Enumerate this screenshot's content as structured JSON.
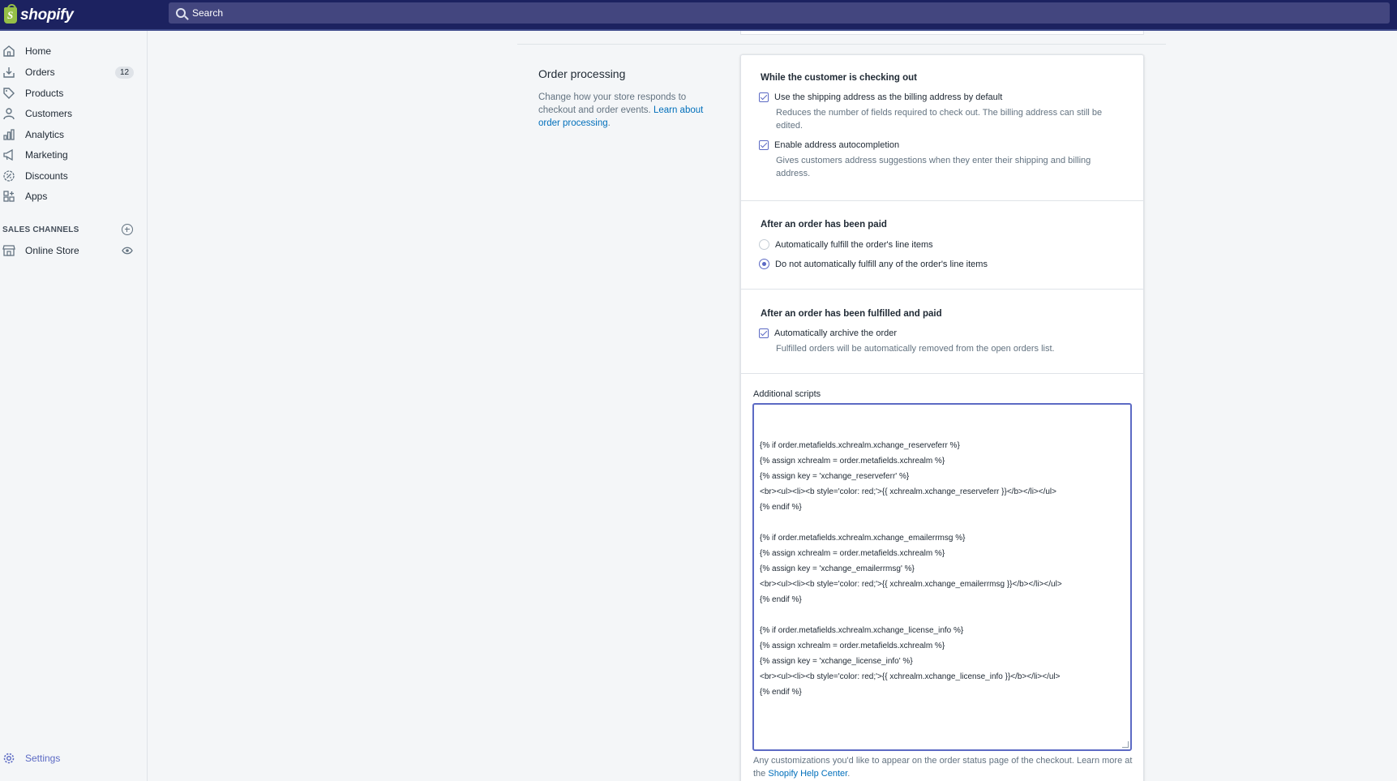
{
  "brand": {
    "name": "shopify"
  },
  "search": {
    "placeholder": "Search"
  },
  "sidebar": {
    "items": [
      {
        "label": "Home",
        "icon": "home-icon"
      },
      {
        "label": "Orders",
        "icon": "orders-icon",
        "badge": "12"
      },
      {
        "label": "Products",
        "icon": "tag-icon"
      },
      {
        "label": "Customers",
        "icon": "person-icon"
      },
      {
        "label": "Analytics",
        "icon": "bar-chart-icon"
      },
      {
        "label": "Marketing",
        "icon": "megaphone-icon"
      },
      {
        "label": "Discounts",
        "icon": "discount-icon"
      },
      {
        "label": "Apps",
        "icon": "apps-icon"
      }
    ],
    "sales_channels_header": "SALES CHANNELS",
    "online_store": "Online Store",
    "settings": "Settings"
  },
  "section": {
    "title": "Order processing",
    "description": "Change how your store responds to checkout and order events.",
    "learn_more": "Learn about order processing",
    "learn_more_period": "."
  },
  "checkout": {
    "title": "While the customer is checking out",
    "opt1_label": "Use the shipping address as the billing address by default",
    "opt1_help": "Reduces the number of fields required to check out. The billing address can still be edited.",
    "opt2_label": "Enable address autocompletion",
    "opt2_help": "Gives customers address suggestions when they enter their shipping and billing address."
  },
  "paid": {
    "title": "After an order has been paid",
    "opt1_label": "Automatically fulfill the order's line items",
    "opt2_label": "Do not automatically fulfill any of the order's line items"
  },
  "fulfilled": {
    "title": "After an order has been fulfilled and paid",
    "opt1_label": "Automatically archive the order",
    "opt1_help": "Fulfilled orders will be automatically removed from the open orders list."
  },
  "scripts": {
    "label": "Additional scripts",
    "lines": [
      "{% if order.metafields.xchrealm.xchange_reserveferr %}",
      "{% assign xchrealm = order.metafields.xchrealm %}",
      "{% assign key = 'xchange_reserveferr' %}",
      "<br><ul><li><b style='color: red;'>{{ xchrealm.xchange_reserveferr }}</b></li></ul>",
      "{% endif %}",
      "",
      "{% if order.metafields.xchrealm.xchange_emailerrmsg %}",
      "{% assign xchrealm = order.metafields.xchrealm %}",
      "{% assign key = 'xchange_emailerrmsg' %}",
      "<br><ul><li><b style='color: red;'>{{ xchrealm.xchange_emailerrmsg }}</b></li></ul>",
      "{% endif %}",
      "",
      "{% if order.metafields.xchrealm.xchange_license_info %}",
      "{% assign xchrealm = order.metafields.xchrealm %}",
      "{% assign key = 'xchange_license_info' %}",
      "<br><ul><li><b style='color: red;'>{{ xchrealm.xchange_license_info }}</b></li></ul>",
      "{% endif %}"
    ],
    "help_text": "Any customizations you'd like to appear on the order status page of the checkout. Learn more at the",
    "help_link": "Shopify Help Center",
    "help_period": "."
  },
  "colors": {
    "topbar": "#1c2260",
    "accent": "#5c6ac4",
    "link": "#006fbb"
  }
}
